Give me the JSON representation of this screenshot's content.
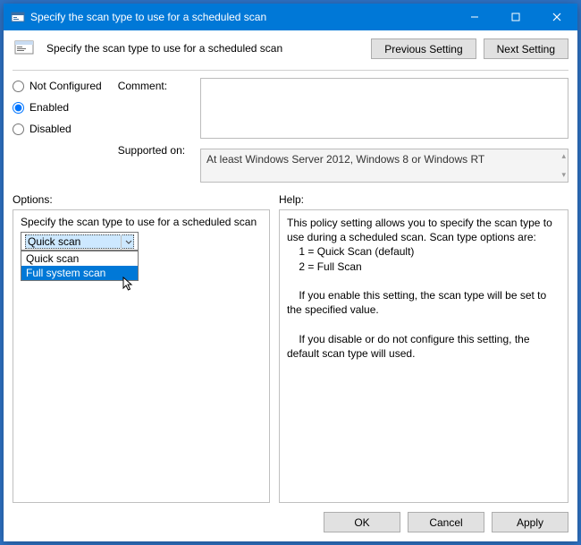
{
  "title": "Specify the scan type to use for a scheduled scan",
  "header_title": "Specify the scan type to use for a scheduled scan",
  "buttons": {
    "prev": "Previous Setting",
    "next": "Next Setting",
    "ok": "OK",
    "cancel": "Cancel",
    "apply": "Apply"
  },
  "state": {
    "not_configured": "Not Configured",
    "enabled": "Enabled",
    "disabled": "Disabled",
    "selected": "enabled"
  },
  "labels": {
    "comment": "Comment:",
    "supported": "Supported on:",
    "options": "Options:",
    "help": "Help:"
  },
  "comment_value": "",
  "supported_text": "At least Windows Server 2012, Windows 8 or Windows RT",
  "options_panel": {
    "label": "Specify the scan type to use for a scheduled scan",
    "selected": "Quick scan",
    "dropdown": [
      "Quick scan",
      "Full system scan"
    ],
    "highlight_index": 1
  },
  "help_text": "This policy setting allows you to specify the scan type to use during a scheduled scan. Scan type options are:\n    1 = Quick Scan (default)\n    2 = Full Scan\n\n    If you enable this setting, the scan type will be set to the specified value.\n\n    If you disable or do not configure this setting, the default scan type will used."
}
